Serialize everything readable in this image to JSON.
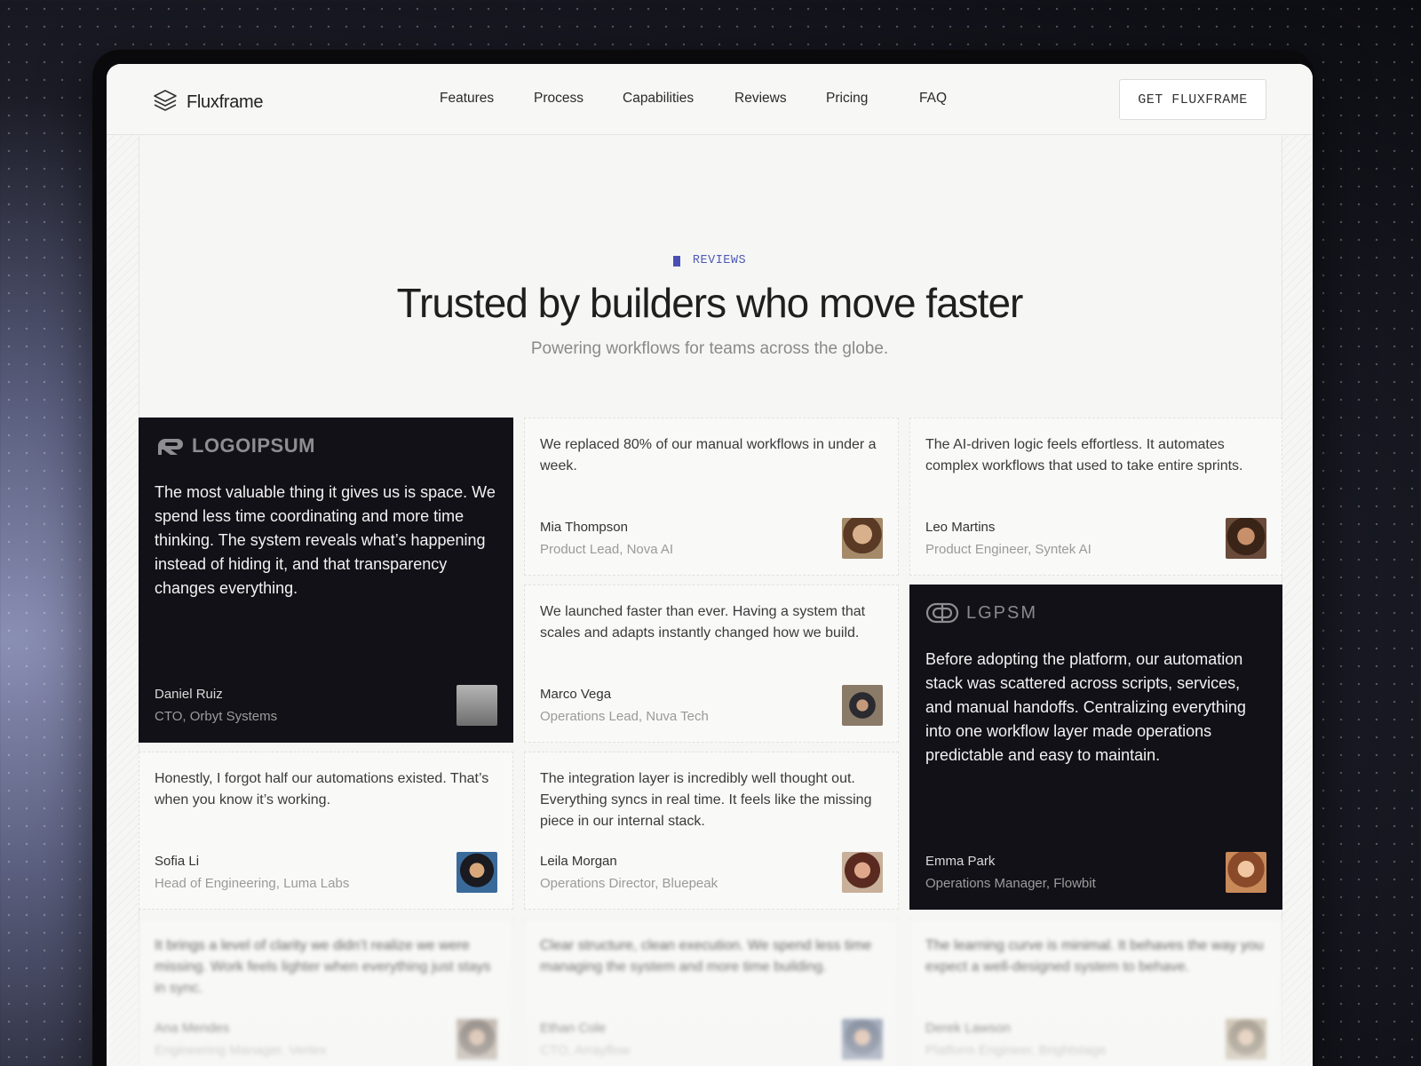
{
  "brand": {
    "name": "Fluxframe"
  },
  "nav": {
    "items": [
      "Features",
      "Process",
      "Capabilities",
      "Reviews",
      "Pricing",
      "FAQ"
    ],
    "cta": "GET FLUXFRAME"
  },
  "section": {
    "eyebrow": "REVIEWS",
    "title": "Trusted by builders who move faster",
    "subtitle": "Powering workflows for teams across the globe."
  },
  "testimonials": [
    {
      "logo": "LOGOIPSUM",
      "quote": "The most valuable thing it gives us is space. We spend less time coordinating and more time thinking. The system reveals what’s happening instead of hiding it, and that transparency changes everything.",
      "name": "Daniel Ruiz",
      "role": "CTO, Orbyt Systems",
      "avatar_color": "#8c8c8c"
    },
    {
      "quote": "We replaced 80% of our manual workflows in under a week.",
      "name": "Mia Thompson",
      "role": "Product Lead, Nova AI",
      "avatar_color": "#7a5a3e"
    },
    {
      "quote": "The AI-driven logic feels effortless. It automates complex workflows that used to take entire sprints.",
      "name": "Leo Martins",
      "role": "Product Engineer, Syntek AI",
      "avatar_color": "#5a3a2a"
    },
    {
      "quote": "We launched faster than ever. Having a system that scales and adapts instantly changed how we build.",
      "name": "Marco Vega",
      "role": "Operations Lead, Nuva Tech",
      "avatar_color": "#6a6258"
    },
    {
      "logo": "LGPSM",
      "quote": "Before adopting the platform, our automation stack was scattered across scripts, services, and manual handoffs. Centralizing everything into one workflow layer made operations predictable and easy to maintain.",
      "name": "Emma Park",
      "role": "Operations Manager, Flowbit",
      "avatar_color": "#b0744a"
    },
    {
      "quote": "Honestly, I forgot half our automations existed. That’s when you know it’s working.",
      "name": "Sofia Li",
      "role": "Head of Engineering, Luma Labs",
      "avatar_color": "#2a4a6a"
    },
    {
      "quote": "The integration layer is incredibly well thought out. Everything syncs in real time. It feels like the missing piece in our internal stack.",
      "name": "Leila Morgan",
      "role": "Operations Director, Bluepeak",
      "avatar_color": "#9a6a55"
    },
    {
      "quote": "It brings a level of clarity we didn’t realize we were missing. Work feels lighter when everything just stays in sync.",
      "name": "Ana Mendes",
      "role": "Engineering Manager, Vertex",
      "avatar_color": "#6a5a50"
    },
    {
      "quote": "Clear structure, clean execution. We spend less time managing the system and more time building.",
      "name": "Ethan Cole",
      "role": "CTO, Arrayflow",
      "avatar_color": "#4a5a7a"
    },
    {
      "quote": "The learning curve is minimal. It behaves the way you expect a well-designed system to behave.",
      "name": "Derek Lawson",
      "role": "Platform Engineer, Brightstage",
      "avatar_color": "#8a7a60"
    }
  ]
}
